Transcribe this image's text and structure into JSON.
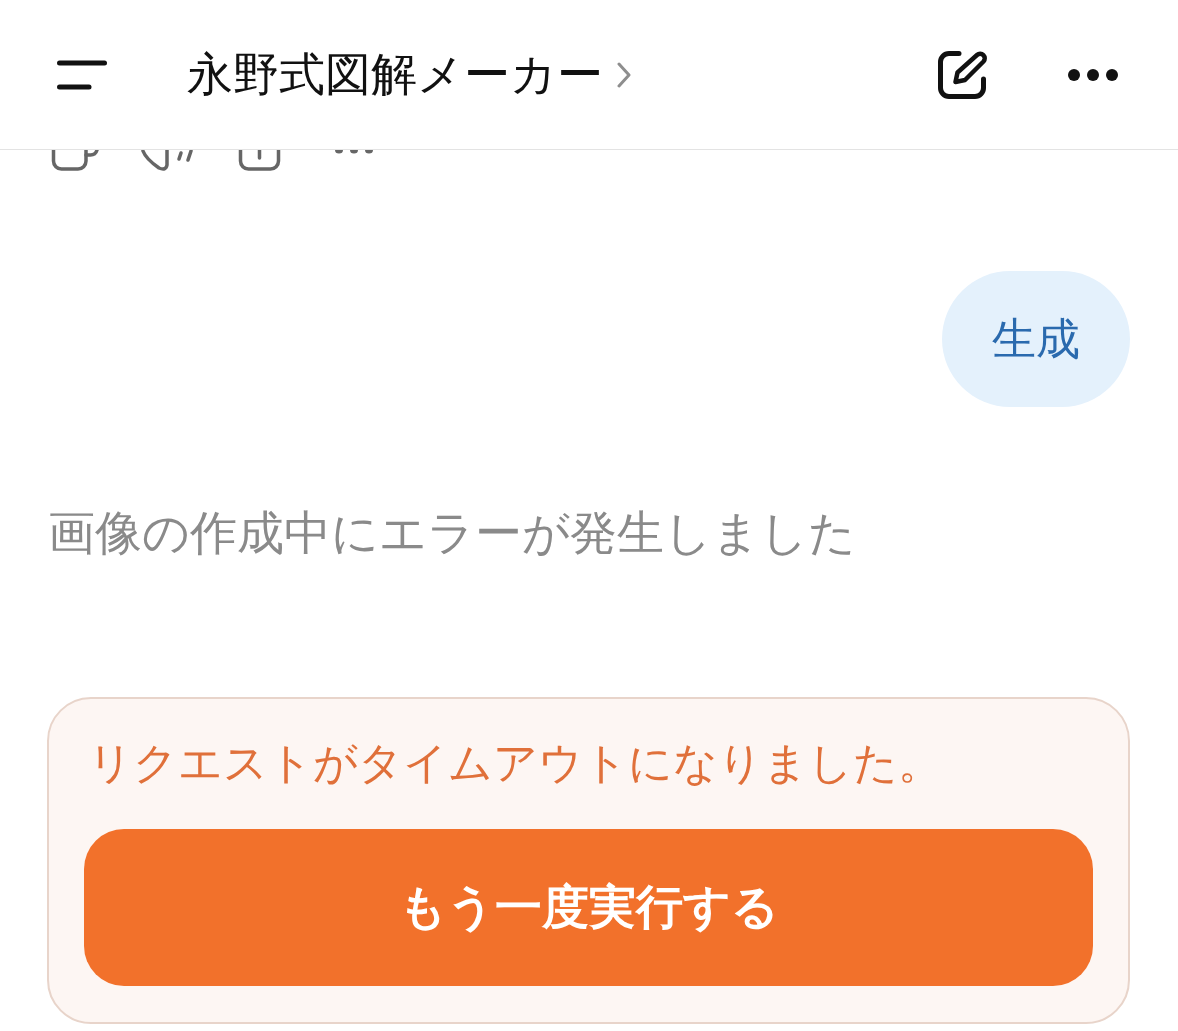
{
  "header": {
    "title": "永野式図解メーカー"
  },
  "messages": [
    {
      "kind": "user",
      "text": "生成"
    },
    {
      "kind": "assistant",
      "text": "画像の作成中にエラーが発生しました"
    }
  ],
  "error_card": {
    "message": "リクエストがタイムアウトになりました。",
    "retry_button": "もう一度実行する"
  }
}
